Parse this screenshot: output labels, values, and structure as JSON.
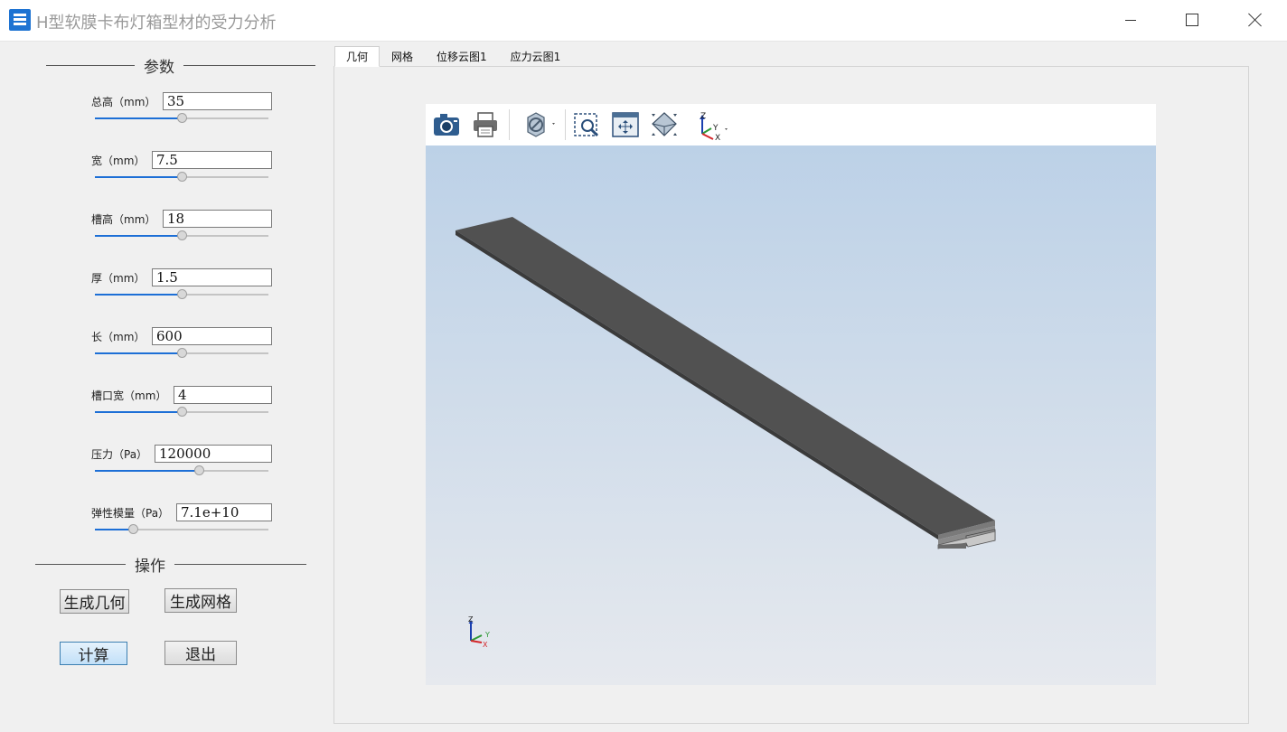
{
  "window": {
    "title": "H型软膜卡布灯箱型材的受力分析"
  },
  "params_section": {
    "title": "参数"
  },
  "params": [
    {
      "label": "总高（mm）",
      "value": "35",
      "slider": 0.5
    },
    {
      "label": "宽（mm）",
      "value": "7.5",
      "slider": 0.5
    },
    {
      "label": "槽高（mm）",
      "value": "18",
      "slider": 0.5
    },
    {
      "label": "厚（mm）",
      "value": "1.5",
      "slider": 0.5
    },
    {
      "label": "长（mm）",
      "value": "600",
      "slider": 0.5
    },
    {
      "label": "槽口宽（mm）",
      "value": "4",
      "slider": 0.5
    },
    {
      "label": "压力（Pa）",
      "value": "120000",
      "slider": 0.6
    },
    {
      "label": "弹性模量（Pa）",
      "value": "7.1e+10",
      "slider": 0.22
    }
  ],
  "ops_section": {
    "title": "操作"
  },
  "buttons": {
    "gen_geometry": "生成几何",
    "gen_mesh": "生成网格",
    "compute": "计算",
    "exit": "退出"
  },
  "tabs": [
    {
      "label": "几何",
      "active": true
    },
    {
      "label": "网格",
      "active": false
    },
    {
      "label": "位移云图1",
      "active": false
    },
    {
      "label": "应力云图1",
      "active": false
    }
  ],
  "viewer": {
    "toolbar": [
      "camera-icon",
      "print-icon",
      "hide-icon",
      "zoom-box-icon",
      "fit-all-icon",
      "view-cube-icon",
      "axis-view-icon"
    ],
    "axis_labels": {
      "z": "Z",
      "y": "Y",
      "x": "X"
    }
  },
  "colors": {
    "accent": "#1d6fd6",
    "viewer_top": "#bcd1e7",
    "viewer_bottom": "#e6e9ee",
    "model": "#515151"
  }
}
